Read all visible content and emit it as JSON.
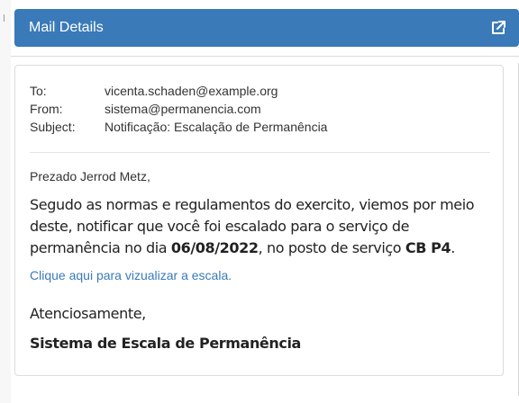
{
  "header": {
    "title": "Mail Details",
    "open_external_icon": "external-link-icon",
    "color": "#3a7ab8"
  },
  "mail": {
    "to_label": "To:",
    "to_value": "vicenta.schaden@example.org",
    "from_label": "From:",
    "from_value": "sistema@permanencia.com",
    "subject_label": "Subject:",
    "subject_value": "Notificação: Escalação de Permanência"
  },
  "body": {
    "greeting": "Prezado Jerrod Metz,",
    "paragraph_part1": "Segudo as normas e regulamentos do exercito, viemos por meio deste, notificar que você foi escalado para o serviço de permanência no dia ",
    "date": "06/08/2022",
    "paragraph_part2": ", no posto de serviço ",
    "post": "CB P4",
    "paragraph_part3": ".",
    "link_text": "Clique aqui para vizualizar a escala.",
    "link_color": "#3a7ab8",
    "closing": "Atenciosamente,",
    "signature": "Sistema de Escala de Permanência"
  }
}
